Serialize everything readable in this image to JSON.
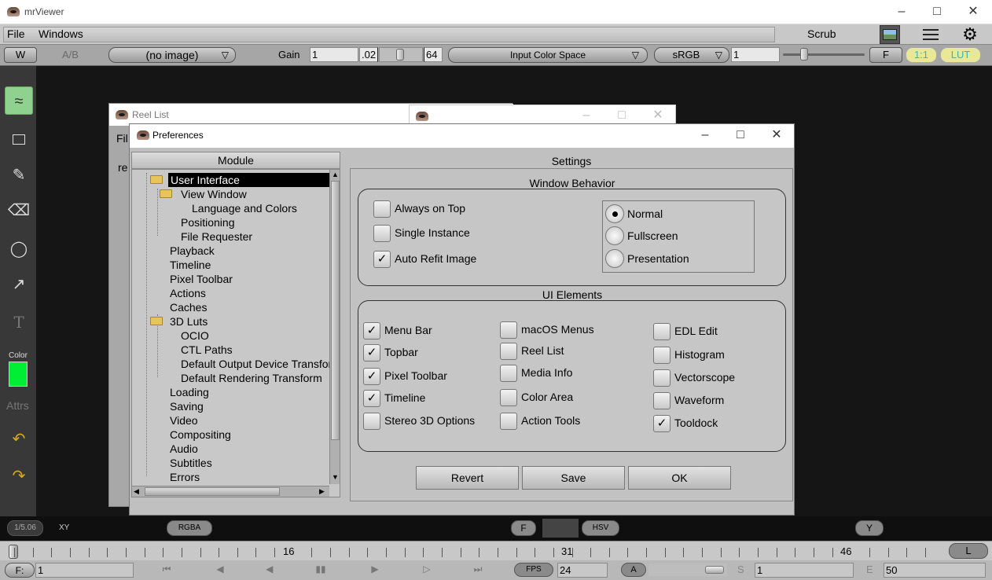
{
  "app": {
    "title": "mrViewer"
  },
  "menubar": {
    "file": "File",
    "windows": "Windows",
    "scrub": "Scrub"
  },
  "topbar": {
    "w": "W",
    "ab": "A/B",
    "image": "(no image)",
    "gain_label": "Gain",
    "gain_value": "1",
    "gain_min": ".02",
    "gain_max": "64",
    "input_color_space": "Input Color Space",
    "display": "sRGB",
    "gamma": "1",
    "f": "F",
    "ratio": "1:1",
    "lut": "LUT"
  },
  "tools": {
    "color_label": "Color",
    "attrs_label": "Attrs",
    "color_swatch": "#00ee33"
  },
  "reel_window": {
    "title": "Reel List",
    "menu_fragment": "Fil",
    "item_fragment": "re"
  },
  "prefs": {
    "title": "Preferences",
    "module_header": "Module",
    "settings_header": "Settings",
    "tree": [
      {
        "label": "User Interface",
        "selected": true
      },
      {
        "label": "View Window"
      },
      {
        "label": "Language and Colors"
      },
      {
        "label": "Positioning"
      },
      {
        "label": "File Requester"
      },
      {
        "label": "Playback"
      },
      {
        "label": "Timeline"
      },
      {
        "label": "Pixel Toolbar"
      },
      {
        "label": "Actions"
      },
      {
        "label": "Caches"
      },
      {
        "label": "3D Luts"
      },
      {
        "label": "OCIO"
      },
      {
        "label": "CTL Paths"
      },
      {
        "label": "Default Output Device Transform"
      },
      {
        "label": "Default Rendering Transform"
      },
      {
        "label": "Loading"
      },
      {
        "label": "Saving"
      },
      {
        "label": "Video"
      },
      {
        "label": "Compositing"
      },
      {
        "label": "Audio"
      },
      {
        "label": "Subtitles"
      },
      {
        "label": "Errors"
      }
    ],
    "window_behavior": {
      "title": "Window Behavior",
      "checks": [
        {
          "label": "Always on Top",
          "checked": false
        },
        {
          "label": "Single Instance",
          "checked": false
        },
        {
          "label": "Auto Refit Image",
          "checked": true
        }
      ],
      "radios": [
        {
          "label": "Normal",
          "selected": true
        },
        {
          "label": "Fullscreen",
          "selected": false
        },
        {
          "label": "Presentation",
          "selected": false
        }
      ]
    },
    "ui_elements": {
      "title": "UI Elements",
      "col1": [
        {
          "label": "Menu Bar",
          "checked": true
        },
        {
          "label": "Topbar",
          "checked": true
        },
        {
          "label": "Pixel Toolbar",
          "checked": true
        },
        {
          "label": "Timeline",
          "checked": true
        },
        {
          "label": "Stereo 3D Options",
          "checked": false
        }
      ],
      "col2": [
        {
          "label": "macOS Menus",
          "checked": false
        },
        {
          "label": "Reel List",
          "checked": false
        },
        {
          "label": "Media Info",
          "checked": false
        },
        {
          "label": "Color Area",
          "checked": false
        },
        {
          "label": "Action Tools",
          "checked": false
        }
      ],
      "col3": [
        {
          "label": "EDL Edit",
          "checked": false
        },
        {
          "label": "Histogram",
          "checked": false
        },
        {
          "label": "Vectorscope",
          "checked": false
        },
        {
          "label": "Waveform",
          "checked": false
        },
        {
          "label": "Tooldock",
          "checked": true
        }
      ]
    },
    "buttons": {
      "revert": "Revert",
      "save": "Save",
      "ok": "OK"
    }
  },
  "pixelbar": {
    "version": "1/5.06",
    "xy": "XY",
    "rgba": "RGBA",
    "f": "F",
    "hsv": "HSV",
    "y": "Y"
  },
  "timeline": {
    "labels": [
      "16",
      "31",
      "46"
    ],
    "l": "L"
  },
  "transport": {
    "frame_label": "F:",
    "frame": "1",
    "fps_label": "FPS",
    "fps": "24",
    "a": "A",
    "s_label": "S",
    "start": "1",
    "e_label": "E",
    "end": "50"
  }
}
